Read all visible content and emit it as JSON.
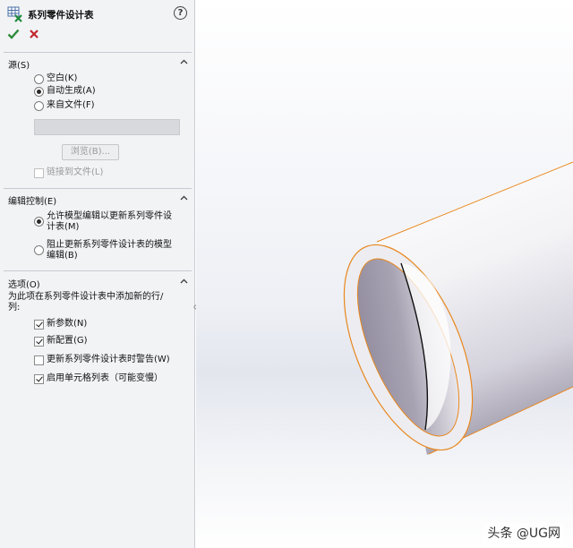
{
  "panel": {
    "title": "系列零件设计表",
    "help_symbol": "?",
    "sections": {
      "source": {
        "title": "源(S)",
        "options": [
          "空白(K)",
          "自动生成(A)",
          "来自文件(F)"
        ],
        "selected": "自动生成(A)",
        "browse_label": "浏览(B)...",
        "link_label": "链接到文件(L)",
        "link_checked": false
      },
      "edit_control": {
        "title": "编辑控制(E)",
        "option1_line1": "允许模型编辑以更新系列零件设",
        "option1_line2": "计表(M)",
        "option2_line1": "阻止更新系列零件设计表的模型",
        "option2_line2": "编辑(B)",
        "selected": "option1"
      },
      "options": {
        "title": "选项(O)",
        "desc_line1": "为此项在系列零件设计表中添加新的行/",
        "desc_line2": "列:",
        "items": [
          {
            "label": "新参数(N)",
            "checked": true
          },
          {
            "label": "新配置(G)",
            "checked": true
          },
          {
            "label": "更新系列零件设计表时警告(W)",
            "checked": false
          },
          {
            "label": "启用单元格列表（可能变慢）",
            "checked": true
          }
        ]
      }
    }
  },
  "viewport": {
    "watermark": "头条 @UG网",
    "edge_color": "#e8871e"
  },
  "icons": [
    "table-icon",
    "help-icon",
    "ok-check-icon",
    "cancel-x-icon",
    "chevron-up-icon"
  ]
}
